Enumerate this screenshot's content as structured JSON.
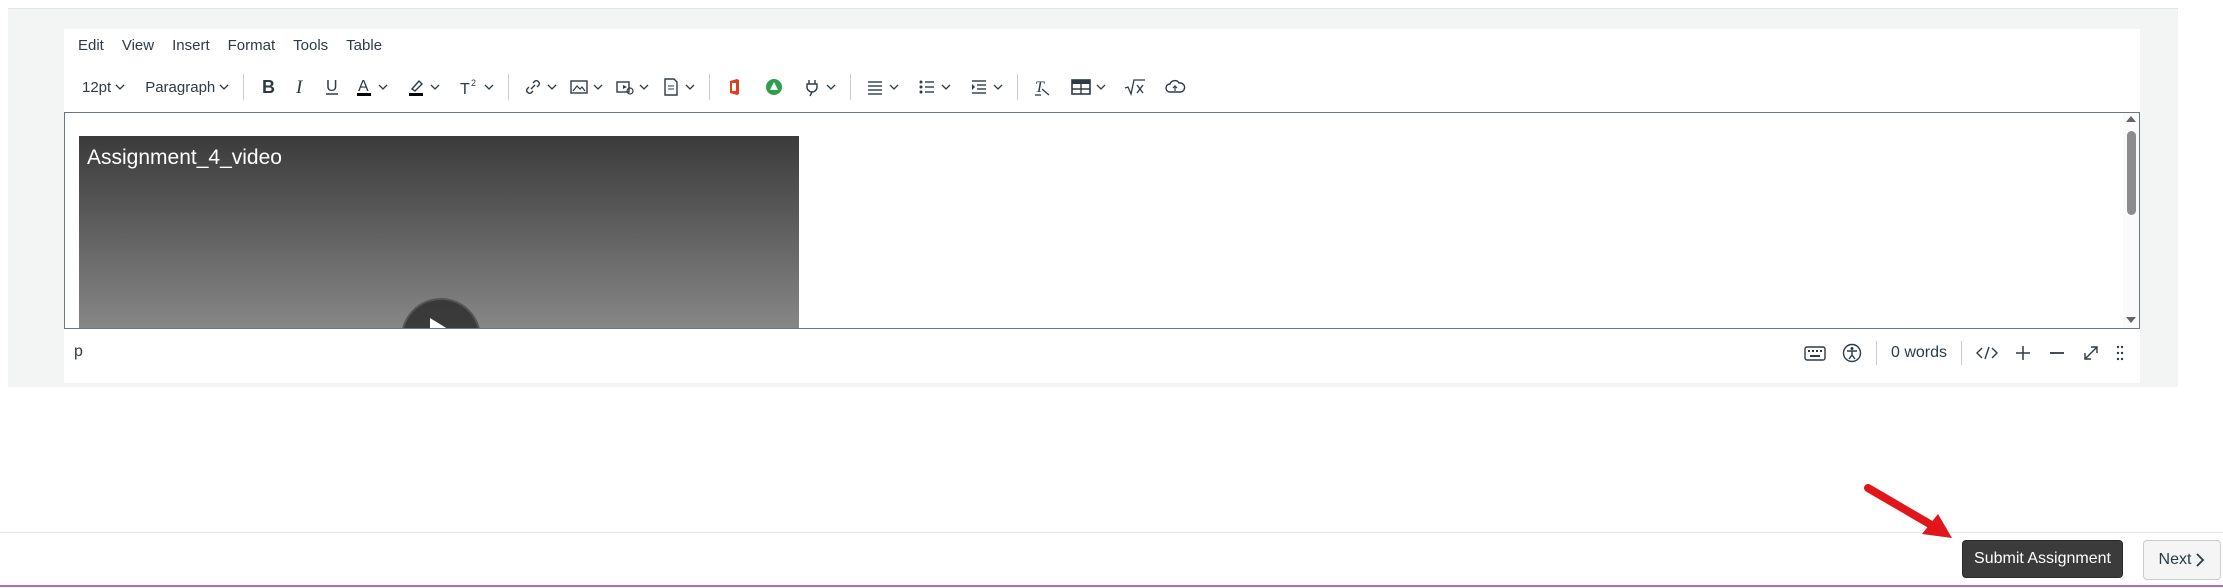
{
  "menubar": {
    "items": [
      "Edit",
      "View",
      "Insert",
      "Format",
      "Tools",
      "Table"
    ]
  },
  "toolbar": {
    "font_size": "12pt",
    "block_format": "Paragraph",
    "icons": [
      "bold-icon",
      "italic-icon",
      "underline-icon",
      "text-color-icon",
      "highlight-icon",
      "superscript-icon",
      "link-icon",
      "image-icon",
      "media-icon",
      "document-icon",
      "office365-icon",
      "apps-icon",
      "plugin-icon",
      "align-icon",
      "bullet-list-icon",
      "indent-icon",
      "clear-format-icon",
      "table-icon",
      "math-icon",
      "cloud-icon"
    ]
  },
  "content": {
    "video_title": "Assignment_4_video"
  },
  "statusbar": {
    "path": "p",
    "word_count": "0 words"
  },
  "footer": {
    "submit_label": "Submit Assignment",
    "next_label": "Next"
  },
  "colors": {
    "arrow": "#e0161b",
    "submit_bg": "#3b3b3b",
    "accent_line": "#b06bb3"
  }
}
